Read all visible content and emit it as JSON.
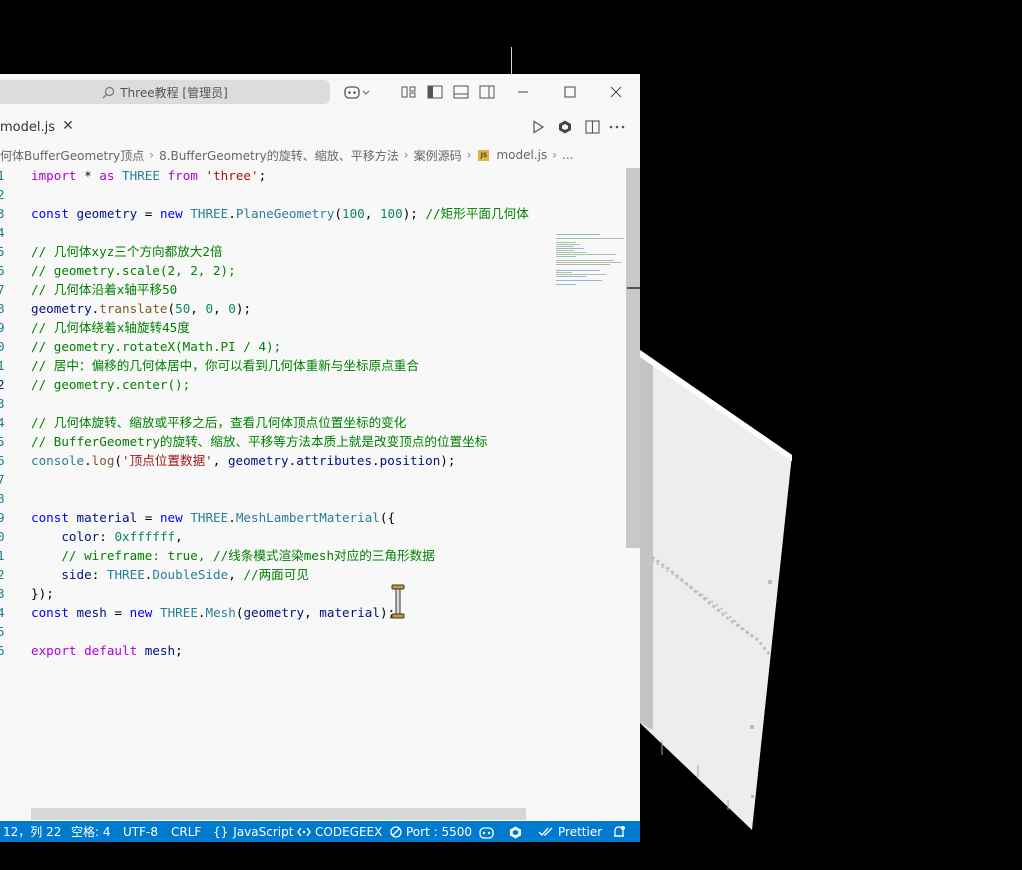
{
  "window": {
    "search_text": "Three教程 [管理员]",
    "colors": {
      "background": "#f8f8f8",
      "status_bar": "#007acc",
      "desktop": "#000000"
    }
  },
  "tab": {
    "label": "model.js",
    "close_icon": "close-icon"
  },
  "titlebar_icons": [
    "copilot-icon",
    "layout-customize-icon",
    "toggle-primary-sidebar-icon",
    "toggle-panel-icon",
    "toggle-secondary-sidebar-icon",
    "minimize-icon",
    "maximize-icon",
    "close-icon"
  ],
  "tabbar_icons": [
    "run-icon",
    "extension-icon",
    "split-editor-icon",
    "more-actions-icon"
  ],
  "breadcrumb": [
    "何体BufferGeometry顶点",
    "8.BufferGeometry的旋转、缩放、平移方法",
    "案例源码",
    "model.js",
    "..."
  ],
  "code": {
    "line_numbers": [
      "1",
      "2",
      "3",
      "4",
      "5",
      "6",
      "7",
      "8",
      "9",
      "0",
      "1",
      "2",
      "3",
      "4",
      "5",
      "6",
      "7",
      "8",
      "9",
      "0",
      "1",
      "2",
      "3",
      "4",
      "5",
      "6"
    ],
    "active_line_index": 11,
    "lines": [
      "import * as THREE from 'three';",
      "",
      "const geometry = new THREE.PlaneGeometry(100, 100); //矩形平面几何体",
      "",
      "// 几何体xyz三个方向都放大2倍",
      "// geometry.scale(2, 2, 2);",
      "// 几何体沿着x轴平移50",
      "geometry.translate(50, 0, 0);",
      "// 几何体绕着x轴旋转45度",
      "// geometry.rotateX(Math.PI / 4);",
      "// 居中：偏移的几何体居中，你可以看到几何体重新与坐标原点重合",
      "// geometry.center();",
      "",
      "// 几何体旋转、缩放或平移之后，查看几何体顶点位置坐标的变化",
      "// BufferGeometry的旋转、缩放、平移等方法本质上就是改变顶点的位置坐标",
      "console.log('顶点位置数据', geometry.attributes.position);",
      "",
      "",
      "const material = new THREE.MeshLambertMaterial({",
      "    color: 0xffffff,",
      "    // wireframe: true, //线条模式渲染mesh对应的三角形数据",
      "    side: THREE.DoubleSide, //两面可见",
      "});",
      "const mesh = new THREE.Mesh(geometry, material);",
      "",
      "export default mesh;"
    ]
  },
  "statusbar": {
    "position": "12，列 22",
    "indent": "空格: 4",
    "encoding": "UTF-8",
    "eol": "CRLF",
    "language": "JavaScript",
    "codegeex": "CODEGEEX",
    "port": "Port : 5500",
    "prettier": "Prettier"
  }
}
